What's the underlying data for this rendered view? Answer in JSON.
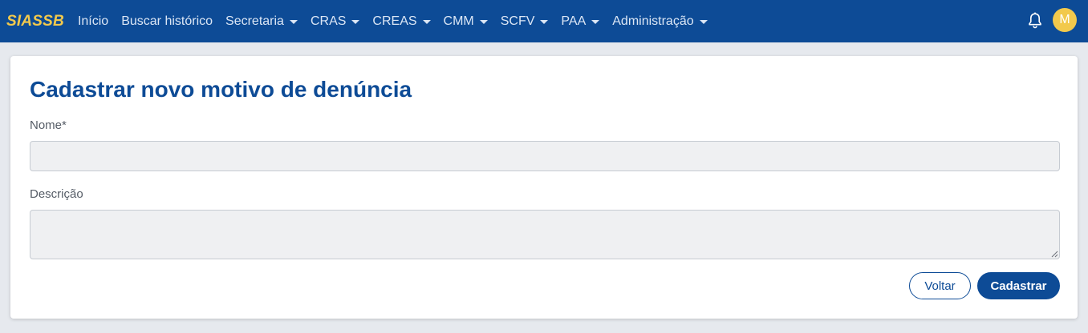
{
  "navbar": {
    "brand": "SIASSB",
    "items": [
      {
        "label": "Início",
        "dropdown": false
      },
      {
        "label": "Buscar histórico",
        "dropdown": false
      },
      {
        "label": "Secretaria",
        "dropdown": true
      },
      {
        "label": "CRAS",
        "dropdown": true
      },
      {
        "label": "CREAS",
        "dropdown": true
      },
      {
        "label": "CMM",
        "dropdown": true
      },
      {
        "label": "SCFV",
        "dropdown": true
      },
      {
        "label": "PAA",
        "dropdown": true
      },
      {
        "label": "Administração",
        "dropdown": true
      }
    ],
    "notifications_icon": "bell-icon",
    "avatar_initial": "M"
  },
  "form": {
    "title": "Cadastrar novo motivo de denúncia",
    "nome_label": "Nome*",
    "nome_value": "",
    "descricao_label": "Descrição",
    "descricao_value": "",
    "back_button": "Voltar",
    "submit_button": "Cadastrar"
  },
  "colors": {
    "primary": "#0d4b96",
    "accent": "#f2c94c",
    "background": "#e6e9ee",
    "input_bg": "#eff0f2"
  }
}
